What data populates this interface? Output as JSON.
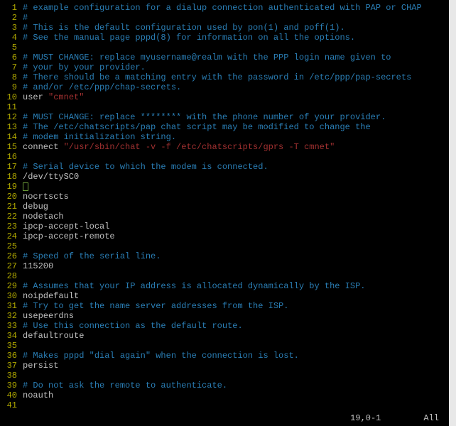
{
  "lines": [
    {
      "n": 1,
      "tokens": [
        {
          "c": "comment",
          "t": "# example configuration for a dialup connection authenticated with PAP or CHAP"
        }
      ]
    },
    {
      "n": 2,
      "tokens": [
        {
          "c": "comment",
          "t": "#"
        }
      ]
    },
    {
      "n": 3,
      "tokens": [
        {
          "c": "comment",
          "t": "# This is the default configuration used by pon(1) and poff(1)."
        }
      ]
    },
    {
      "n": 4,
      "tokens": [
        {
          "c": "comment",
          "t": "# See the manual page pppd(8) for information on all the options."
        }
      ]
    },
    {
      "n": 5,
      "tokens": []
    },
    {
      "n": 6,
      "tokens": [
        {
          "c": "comment",
          "t": "# MUST CHANGE: replace myusername@realm with the PPP login name given to"
        }
      ]
    },
    {
      "n": 7,
      "tokens": [
        {
          "c": "comment",
          "t": "# your by your provider."
        }
      ]
    },
    {
      "n": 8,
      "tokens": [
        {
          "c": "comment",
          "t": "# There should be a matching entry with the password in /etc/ppp/pap-secrets"
        }
      ]
    },
    {
      "n": 9,
      "tokens": [
        {
          "c": "comment",
          "t": "# and/or /etc/ppp/chap-secrets."
        }
      ]
    },
    {
      "n": 10,
      "tokens": [
        {
          "c": "keyword",
          "t": "user "
        },
        {
          "c": "string",
          "t": "\"cmnet\""
        }
      ]
    },
    {
      "n": 11,
      "tokens": []
    },
    {
      "n": 12,
      "tokens": [
        {
          "c": "comment",
          "t": "# MUST CHANGE: replace ******** with the phone number of your provider."
        }
      ]
    },
    {
      "n": 13,
      "tokens": [
        {
          "c": "comment",
          "t": "# The /etc/chatscripts/pap chat script may be modified to change the"
        }
      ]
    },
    {
      "n": 14,
      "tokens": [
        {
          "c": "comment",
          "t": "# modem initialization string."
        }
      ]
    },
    {
      "n": 15,
      "tokens": [
        {
          "c": "keyword",
          "t": "connect "
        },
        {
          "c": "string",
          "t": "\"/usr/sbin/chat -v -f /etc/chatscripts/gprs -T cmnet\""
        }
      ]
    },
    {
      "n": 16,
      "tokens": []
    },
    {
      "n": 17,
      "tokens": [
        {
          "c": "comment",
          "t": "# Serial device to which the modem is connected."
        }
      ]
    },
    {
      "n": 18,
      "tokens": [
        {
          "c": "keyword",
          "t": "/dev/ttySC0"
        }
      ]
    },
    {
      "n": 19,
      "tokens": [],
      "cursor": true
    },
    {
      "n": 20,
      "tokens": [
        {
          "c": "keyword",
          "t": "nocrtscts"
        }
      ]
    },
    {
      "n": 21,
      "tokens": [
        {
          "c": "keyword",
          "t": "debug"
        }
      ]
    },
    {
      "n": 22,
      "tokens": [
        {
          "c": "keyword",
          "t": "nodetach"
        }
      ]
    },
    {
      "n": 23,
      "tokens": [
        {
          "c": "keyword",
          "t": "ipcp-accept-local"
        }
      ]
    },
    {
      "n": 24,
      "tokens": [
        {
          "c": "keyword",
          "t": "ipcp-accept-remote"
        }
      ]
    },
    {
      "n": 25,
      "tokens": []
    },
    {
      "n": 26,
      "tokens": [
        {
          "c": "comment",
          "t": "# Speed of the serial line."
        }
      ]
    },
    {
      "n": 27,
      "tokens": [
        {
          "c": "keyword",
          "t": "115200"
        }
      ]
    },
    {
      "n": 28,
      "tokens": []
    },
    {
      "n": 29,
      "tokens": [
        {
          "c": "comment",
          "t": "# Assumes that your IP address is allocated dynamically by the ISP."
        }
      ]
    },
    {
      "n": 30,
      "tokens": [
        {
          "c": "keyword",
          "t": "noipdefault"
        }
      ]
    },
    {
      "n": 31,
      "tokens": [
        {
          "c": "comment",
          "t": "# Try to get the name server addresses from the ISP."
        }
      ]
    },
    {
      "n": 32,
      "tokens": [
        {
          "c": "keyword",
          "t": "usepeerdns"
        }
      ]
    },
    {
      "n": 33,
      "tokens": [
        {
          "c": "comment",
          "t": "# Use this connection as the default route."
        }
      ]
    },
    {
      "n": 34,
      "tokens": [
        {
          "c": "keyword",
          "t": "defaultroute"
        }
      ]
    },
    {
      "n": 35,
      "tokens": []
    },
    {
      "n": 36,
      "tokens": [
        {
          "c": "comment",
          "t": "# Makes pppd \"dial again\" when the connection is lost."
        }
      ]
    },
    {
      "n": 37,
      "tokens": [
        {
          "c": "keyword",
          "t": "persist"
        }
      ]
    },
    {
      "n": 38,
      "tokens": []
    },
    {
      "n": 39,
      "tokens": [
        {
          "c": "comment",
          "t": "# Do not ask the remote to authenticate."
        }
      ]
    },
    {
      "n": 40,
      "tokens": [
        {
          "c": "keyword",
          "t": "noauth"
        }
      ]
    },
    {
      "n": 41,
      "tokens": []
    }
  ],
  "status": {
    "position": "19,0-1",
    "scroll": "All"
  }
}
